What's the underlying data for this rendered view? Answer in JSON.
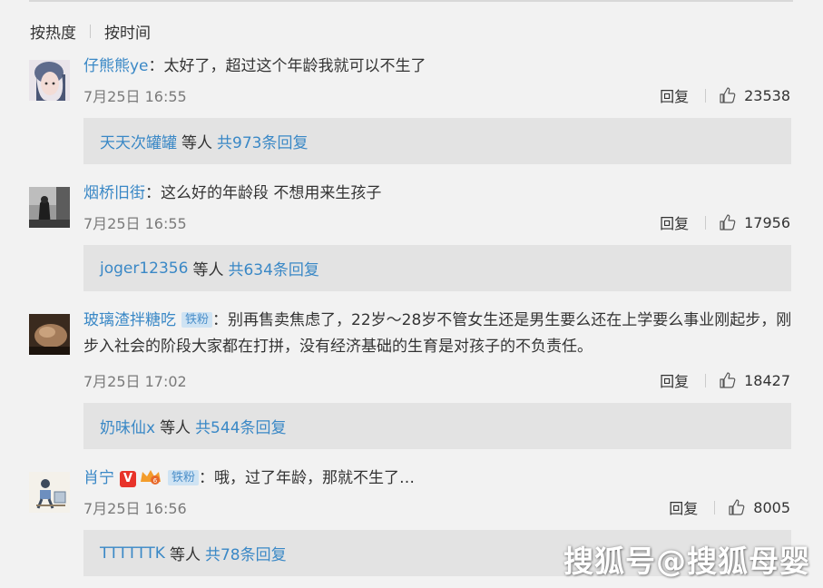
{
  "sort": {
    "hot": "按热度",
    "time": "按时间"
  },
  "comments": [
    {
      "user": "仔熊熊ye",
      "separator": "：",
      "text": "太好了，超过这个年龄我就可以不生了",
      "time": "7月25日 16:55",
      "reply_label": "回复",
      "likes": "23538",
      "reply_by": "天天次罐罐",
      "reply_mid": "等人",
      "reply_count": "共973条回复"
    },
    {
      "user": "烟桥旧街",
      "separator": "：",
      "text": "这么好的年龄段 不想用来生孩子",
      "time": "7月25日 16:55",
      "reply_label": "回复",
      "likes": "17956",
      "reply_by": "joger12356",
      "reply_mid": "等人",
      "reply_count": "共634条回复"
    },
    {
      "user": "玻璃渣拌糖吃",
      "badge": "铁粉",
      "separator": "：",
      "text": "别再售卖焦虑了，22岁～28岁不管女生还是男生要么还在上学要么事业刚起步，刚步入社会的阶段大家都在打拼，没有经济基础的生育是对孩子的不负责任。",
      "time": "7月25日 17:02",
      "reply_label": "回复",
      "likes": "18427",
      "reply_by": "奶味仙x",
      "reply_mid": "等人",
      "reply_count": "共544条回复"
    },
    {
      "user": "肖宁",
      "vbadge": "V",
      "badge": "铁粉",
      "separator": "：",
      "text": "哦，过了年龄，那就不生了…",
      "time": "7月25日 16:56",
      "reply_label": "回复",
      "likes": "8005",
      "reply_by": "TTTTTTK",
      "reply_mid": "等人",
      "reply_count": "共78条回复"
    }
  ],
  "watermark": "搜狐号@搜狐母婴",
  "colors": {
    "link": "#3a88c6",
    "badge_bg": "#cfe3f3",
    "reply_box": "#e3e3e3"
  },
  "icons": {
    "like": "thumbs-up-icon"
  }
}
